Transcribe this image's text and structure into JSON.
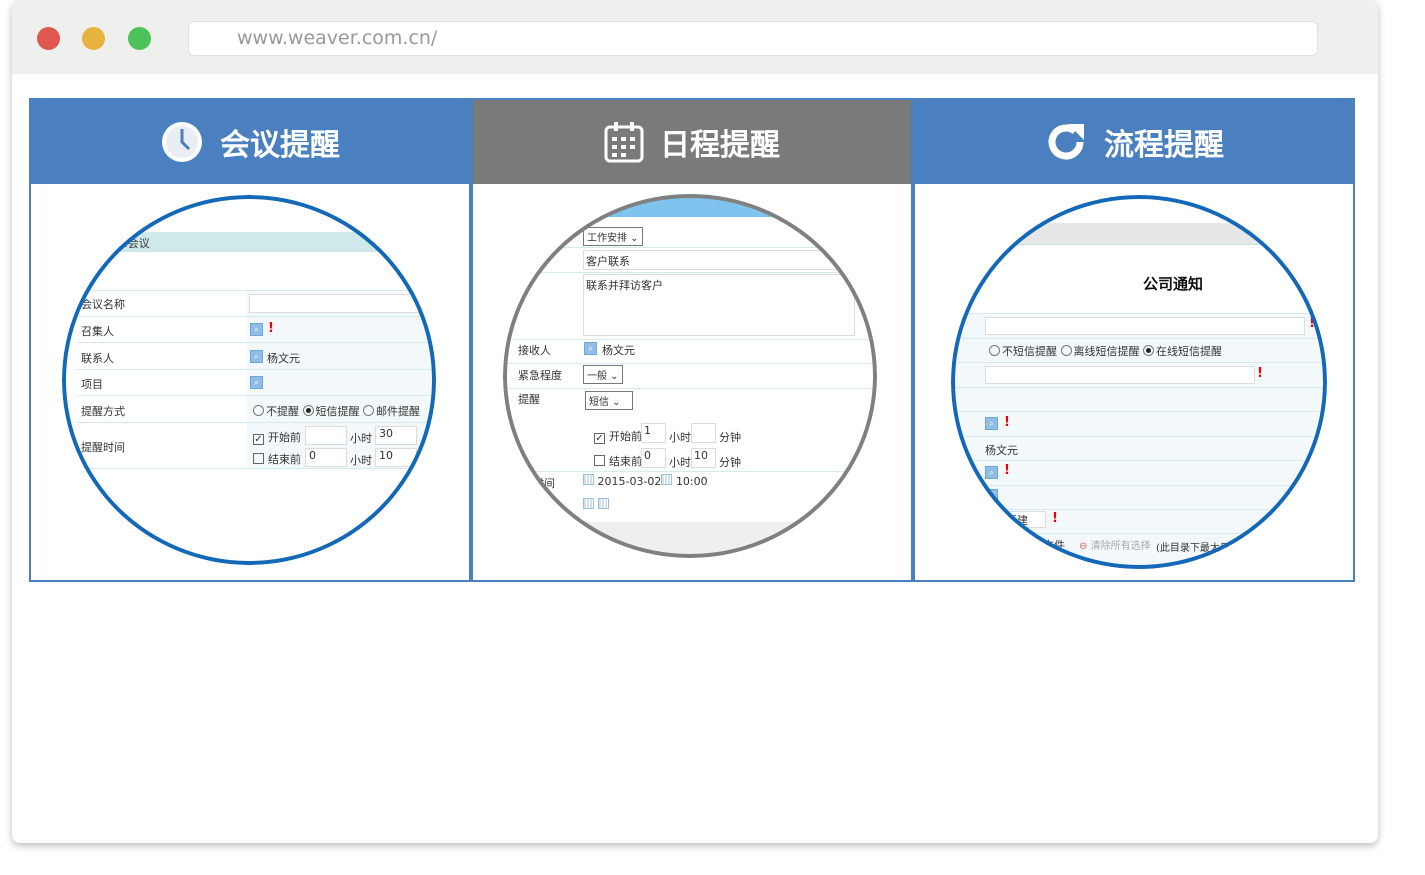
{
  "browser": {
    "url": "www.weaver.com.cn/",
    "dots": [
      "#e0574f",
      "#e8b23f",
      "#4ec25a"
    ]
  },
  "colors": {
    "header_blue": "#4a80bf",
    "header_gray": "#7a7a7a",
    "ring_blue": "#1468b8"
  },
  "panels": [
    {
      "title": "会议提醒",
      "icon": "clock-icon",
      "form": {
        "header": "新建:会议",
        "rows": {
          "name": "会议名称",
          "caller": "召集人",
          "contact": "联系人",
          "contact_value": "杨文元",
          "project": "项目",
          "method": "提醒方式",
          "time": "提醒时间"
        },
        "methods": [
          "不提醒",
          "短信提醒",
          "邮件提醒"
        ],
        "method_selected": 1,
        "before_start": "开始前",
        "before_end": "结束前",
        "hour": "小时",
        "start_checked": true,
        "end_checked": false,
        "start_hours": "",
        "start_minutes": "30",
        "end_hours": "0",
        "end_minutes": "10"
      }
    },
    {
      "title": "日程提醒",
      "icon": "calendar-icon",
      "form": {
        "type": "工作安排",
        "title_value": "客户联系",
        "content_value": "联系并拜访客户",
        "receiver_label": "接收人",
        "receiver": "杨文元",
        "urgency_label": "紧急程度",
        "urgency": "一般",
        "remind_label": "提醒",
        "remind": "短信",
        "before_start": "开始前",
        "before_end": "结束前",
        "hour": "小时",
        "minute": "分钟",
        "start_checked": true,
        "end_checked": false,
        "start_hours": "1",
        "start_minutes": "",
        "end_hours": "0",
        "end_minutes": "10",
        "time_label": "时间",
        "date": "2015-03-02",
        "time": "10:00"
      }
    },
    {
      "title": "流程提醒",
      "icon": "refresh-icon",
      "form": {
        "title": "公司通知",
        "sms": [
          "不短信提醒",
          "离线短信提醒",
          "在线短信提醒"
        ],
        "sms_selected": 2,
        "person": "杨文元",
        "new_btn": "新建",
        "file": "文件",
        "clear": "清除所有选择",
        "note": "(此目录下最大只"
      }
    }
  ]
}
